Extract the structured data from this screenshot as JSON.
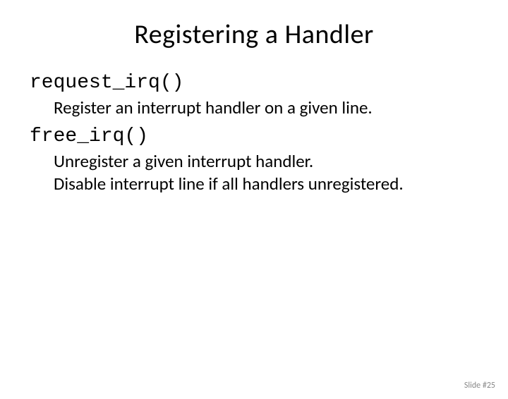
{
  "title": "Registering a Handler",
  "items": [
    {
      "code": "request_irq()",
      "desc_lines": [
        "Register an interrupt handler on a given line."
      ]
    },
    {
      "code": "free_irq()",
      "desc_lines": [
        "Unregister a given interrupt handler.",
        "Disable interrupt line if all handlers unregistered."
      ]
    }
  ],
  "footer": "Slide #25"
}
